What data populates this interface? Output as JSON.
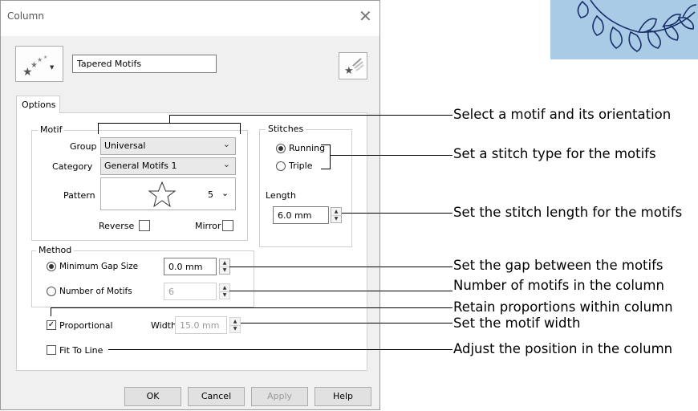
{
  "window": {
    "title": "Column"
  },
  "top": {
    "motif_name": "Tapered Motifs"
  },
  "tabs": [
    {
      "label": "Options"
    }
  ],
  "motif": {
    "legend": "Motif",
    "group_label": "Group",
    "group_value": "Universal",
    "category_label": "Category",
    "category_value": "General Motifs 1",
    "pattern_label": "Pattern",
    "pattern_number": "5",
    "reverse_label": "Reverse",
    "mirror_label": "Mirror"
  },
  "stitches": {
    "legend": "Stitches",
    "running_label": "Running",
    "triple_label": "Triple",
    "selected": "Running",
    "length_label": "Length",
    "length_value": "6.0 mm"
  },
  "method": {
    "legend": "Method",
    "min_gap_label": "Minimum Gap Size",
    "min_gap_value": "0.0 mm",
    "num_motifs_label": "Number of Motifs",
    "num_motifs_value": "6",
    "selected": "Minimum Gap Size"
  },
  "proportional": {
    "label": "Proportional",
    "checked": true,
    "width_label": "Width",
    "width_value": "15.0 mm"
  },
  "fit_to_line": {
    "label": "Fit To Line",
    "checked": false
  },
  "buttons": {
    "ok": "OK",
    "cancel": "Cancel",
    "apply": "Apply",
    "help": "Help"
  },
  "annotations": {
    "motif_orientation": "Select a motif and its orientation",
    "stitch_type": "Set a stitch type for the motifs",
    "stitch_length": "Set the stitch length for the motifs",
    "gap": "Set the gap between the motifs",
    "num_motifs": "Number of motifs in the column",
    "proportions": "Retain proportions within column",
    "motif_width": "Set the motif width",
    "position": "Adjust the position in the column"
  },
  "colors": {
    "dialog_bg": "#f0f0f0",
    "thumbnail_bg": "#a9cbe6",
    "thumbnail_stitch": "#1b2f6b"
  }
}
